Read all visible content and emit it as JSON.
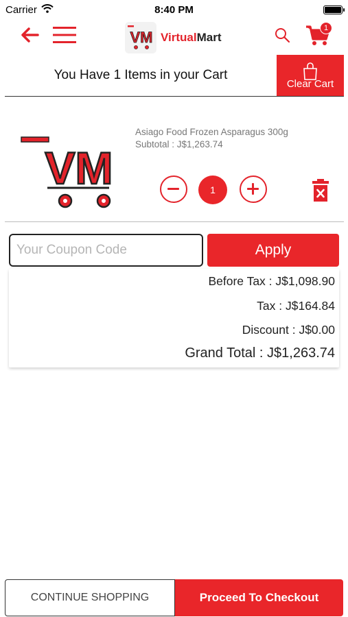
{
  "status_bar": {
    "carrier": "Carrier",
    "time": "8:40 PM"
  },
  "header": {
    "brand_logo_text": "VM",
    "brand_name_1": "Virtual",
    "brand_name_2": "Mart",
    "cart_count": "1",
    "accent_color": "#e3232b"
  },
  "cart": {
    "title": "You Have 1 Items in your Cart",
    "clear_label": "Clear Cart"
  },
  "items": [
    {
      "name": "Asiago Food Frozen Asparagus 300g",
      "subtotal": "Subtotal : J$1,263.74",
      "quantity": "1",
      "image_logo_text": "VM"
    }
  ],
  "coupon": {
    "placeholder": "Your Coupon Code",
    "apply_label": "Apply"
  },
  "totals": {
    "before_tax": "Before Tax : J$1,098.90",
    "tax": "Tax : J$164.84",
    "discount": "Discount : J$0.00",
    "grand_total": "Grand Total : J$1,263.74"
  },
  "footer": {
    "continue_label": "CONTINUE SHOPPING",
    "checkout_label": "Proceed To Checkout"
  }
}
